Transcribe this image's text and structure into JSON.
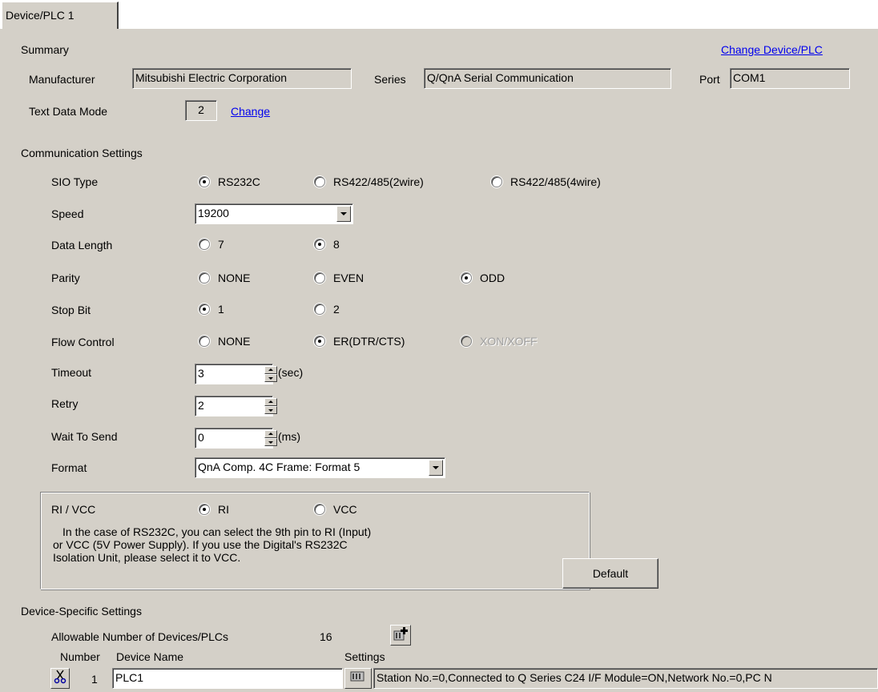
{
  "tab": {
    "label": "Device/PLC 1"
  },
  "summary": {
    "heading": "Summary",
    "change_device_link": "Change Device/PLC",
    "manufacturer_label": "Manufacturer",
    "manufacturer_value": "Mitsubishi Electric Corporation",
    "series_label": "Series",
    "series_value": "Q/QnA Serial Communication",
    "port_label": "Port",
    "port_value": "COM1",
    "text_data_mode_label": "Text Data Mode",
    "text_data_mode_value": "2",
    "change_link": "Change"
  },
  "comm": {
    "heading": "Communication Settings",
    "sio_type": {
      "label": "SIO Type",
      "options": [
        "RS232C",
        "RS422/485(2wire)",
        "RS422/485(4wire)"
      ],
      "selected": "RS232C"
    },
    "speed": {
      "label": "Speed",
      "value": "19200"
    },
    "data_length": {
      "label": "Data Length",
      "options": [
        "7",
        "8"
      ],
      "selected": "8"
    },
    "parity": {
      "label": "Parity",
      "options": [
        "NONE",
        "EVEN",
        "ODD"
      ],
      "selected": "ODD"
    },
    "stop_bit": {
      "label": "Stop Bit",
      "options": [
        "1",
        "2"
      ],
      "selected": "1"
    },
    "flow_control": {
      "label": "Flow Control",
      "options": [
        "NONE",
        "ER(DTR/CTS)",
        "XON/XOFF"
      ],
      "selected": "ER(DTR/CTS)",
      "disabled": [
        "XON/XOFF"
      ]
    },
    "timeout": {
      "label": "Timeout",
      "value": "3",
      "unit": "(sec)"
    },
    "retry": {
      "label": "Retry",
      "value": "2"
    },
    "wait_to_send": {
      "label": "Wait To Send",
      "value": "0",
      "unit": "(ms)"
    },
    "format": {
      "label": "Format",
      "value": "QnA Comp. 4C Frame: Format 5"
    }
  },
  "ri_vcc": {
    "label": "RI / VCC",
    "options": [
      "RI",
      "VCC"
    ],
    "selected": "RI",
    "note_line1": "In the case of RS232C, you can select the 9th pin to RI (Input)",
    "note_line2": "or VCC (5V Power Supply). If you use the Digital's RS232C",
    "note_line3": "Isolation Unit, please select it to VCC."
  },
  "default_button": "Default",
  "device_specific": {
    "heading": "Device-Specific Settings",
    "allowable_label": "Allowable Number of Devices/PLCs",
    "allowable_value": "16",
    "col_number": "Number",
    "col_device_name": "Device Name",
    "col_settings": "Settings",
    "rows": [
      {
        "number": "1",
        "device_name": "PLC1",
        "settings": "Station No.=0,Connected to Q Series C24 I/F Module=ON,Network No.=0,PC N"
      }
    ]
  }
}
